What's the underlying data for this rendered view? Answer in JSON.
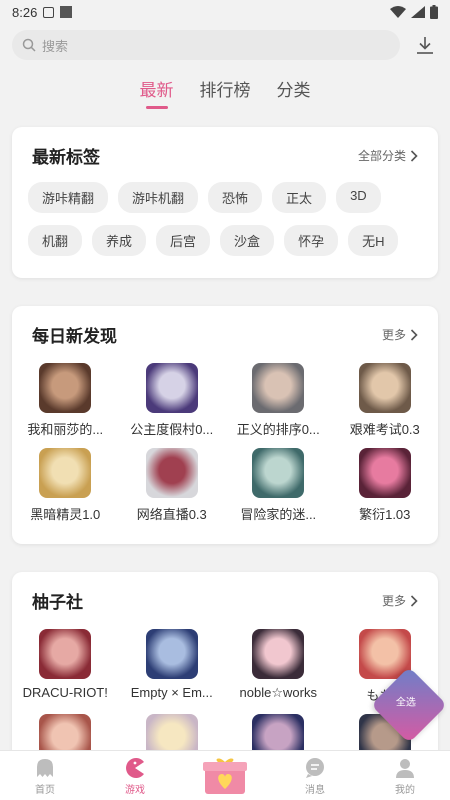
{
  "status": {
    "time": "8:26"
  },
  "search": {
    "placeholder": "搜索"
  },
  "tabs": [
    {
      "label": "最新",
      "active": true
    },
    {
      "label": "排行榜",
      "active": false
    },
    {
      "label": "分类",
      "active": false
    }
  ],
  "latest_tags": {
    "title": "最新标签",
    "more": "全部分类",
    "tags": [
      "游咔精翻",
      "游咔机翻",
      "恐怖",
      "正太",
      "3D",
      "机翻",
      "养成",
      "后宫",
      "沙盒",
      "怀孕",
      "无H"
    ]
  },
  "daily": {
    "title": "每日新发现",
    "more": "更多",
    "games": [
      {
        "name": "我和丽莎的...",
        "colors": [
          "#5a3a2c",
          "#c79a7c"
        ]
      },
      {
        "name": "公主度假村0...",
        "colors": [
          "#4b3a7a",
          "#d6d2e6"
        ]
      },
      {
        "name": "正义的排序0...",
        "colors": [
          "#6b6b70",
          "#d9c2b4"
        ]
      },
      {
        "name": "艰难考试0.3",
        "colors": [
          "#6e5a49",
          "#e2c7aa"
        ]
      },
      {
        "name": "黑暗精灵1.0",
        "colors": [
          "#c9a052",
          "#f1dfb3"
        ]
      },
      {
        "name": "网络直播0.3",
        "colors": [
          "#d7d7db",
          "#a04050"
        ]
      },
      {
        "name": "冒险家的迷...",
        "colors": [
          "#3f6a6a",
          "#bcd6cf"
        ]
      },
      {
        "name": "繁衍1.03",
        "colors": [
          "#5a2338",
          "#e77ba0"
        ]
      }
    ]
  },
  "yuzu": {
    "title": "柚子社",
    "more": "更多",
    "games": [
      {
        "name": "DRACU-RIOT!",
        "colors": [
          "#8a2b36",
          "#e6a9a4"
        ]
      },
      {
        "name": "Empty × Em...",
        "colors": [
          "#2d3e75",
          "#a9bde0"
        ]
      },
      {
        "name": "noble☆works",
        "colors": [
          "#3b2c39",
          "#f1c7cf"
        ]
      },
      {
        "name": "もも...",
        "colors": [
          "#c44a4a",
          "#f3c1a7"
        ]
      },
      {
        "name": "",
        "colors": [
          "#a8554a",
          "#f0c4b2"
        ]
      },
      {
        "name": "",
        "colors": [
          "#c9b6c6",
          "#f6e7c1"
        ]
      },
      {
        "name": "",
        "colors": [
          "#2b2f62",
          "#c7a3c3"
        ]
      },
      {
        "name": "",
        "colors": [
          "#2f3448",
          "#b69a8a"
        ]
      }
    ]
  },
  "floating_badge": {
    "label": "全选"
  },
  "bottom_nav": [
    {
      "label": "首页",
      "icon": "ghost-icon",
      "active": false
    },
    {
      "label": "游戏",
      "icon": "pacman-icon",
      "active": true
    },
    {
      "label": "",
      "icon": "gift-icon",
      "active": false
    },
    {
      "label": "消息",
      "icon": "chat-icon",
      "active": false
    },
    {
      "label": "我的",
      "icon": "user-icon",
      "active": false
    }
  ],
  "colors": {
    "accent": "#e05a8a",
    "background": "#f2f2f2",
    "card": "#ffffff",
    "tag_bg": "#efefef"
  }
}
